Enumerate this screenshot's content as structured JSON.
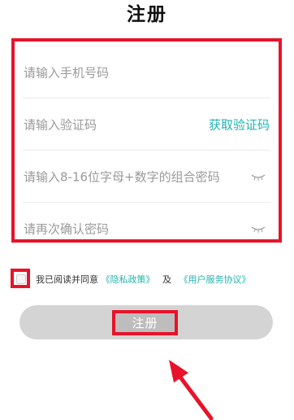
{
  "header": {
    "title": "注册"
  },
  "form": {
    "phone_placeholder": "请输入手机号码",
    "code_placeholder": "请输入验证码",
    "get_code_label": "获取验证码",
    "password_placeholder": "请输入8-16位字母+数字的组合密码",
    "confirm_placeholder": "请再次确认密码"
  },
  "agreement": {
    "prefix": "我已阅读并同意",
    "privacy_link": "《隐私政策》",
    "and": "及",
    "service_link": "《用户服务协议》",
    "checked": false
  },
  "register_button": {
    "label": "注册",
    "enabled": false
  },
  "colors": {
    "accent": "#22b3b0",
    "annotation": "#e8132a",
    "disabled_button": "#d4d4d4"
  },
  "icons": [
    "eye-closed-icon",
    "arrow-annotation"
  ]
}
